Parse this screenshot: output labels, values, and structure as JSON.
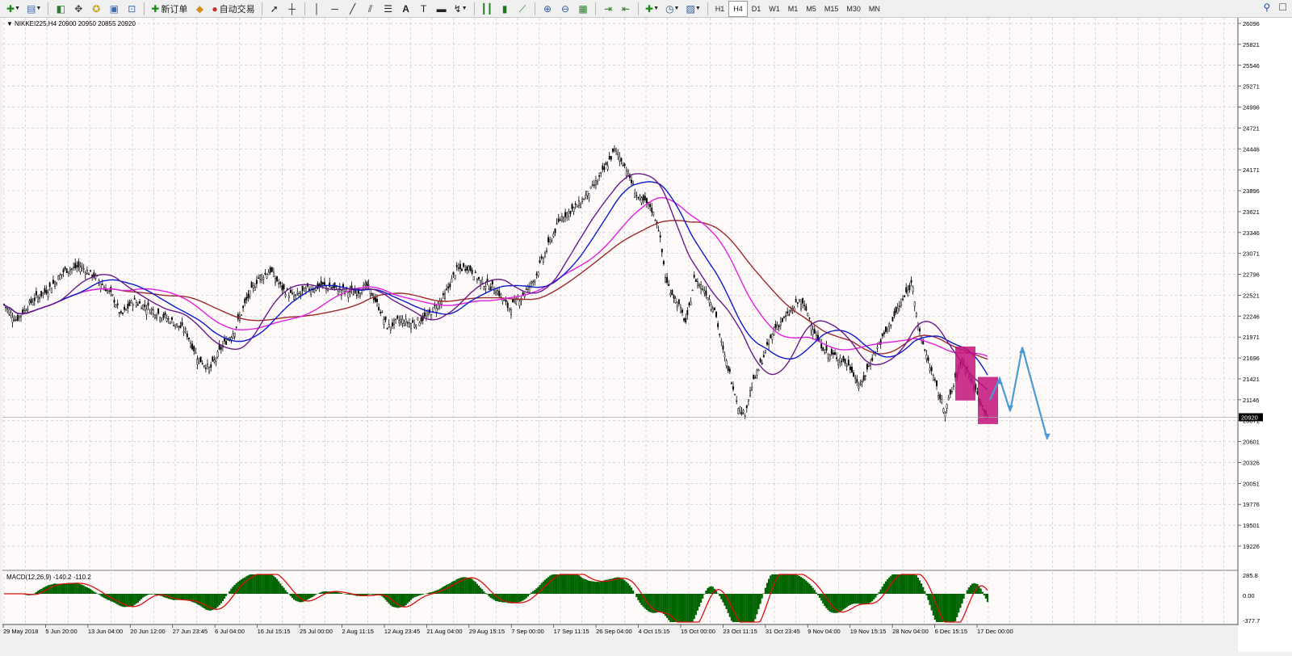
{
  "toolbar": {
    "new_order_label": "新订单",
    "auto_trade_label": "自动交易",
    "timeframes": [
      "H1",
      "H4",
      "D1",
      "W1",
      "M1",
      "M5",
      "M15",
      "M30",
      "MN"
    ],
    "active_timeframe": "H4"
  },
  "chart": {
    "header": "NIKKEI225,H4  20900 20950 20855 20920",
    "current_price_label": "20920",
    "y_axis_labels": [
      "26096",
      "25821",
      "25546",
      "25271",
      "24996",
      "24721",
      "24446",
      "24171",
      "23896",
      "23621",
      "23346",
      "23071",
      "22796",
      "22521",
      "22246",
      "21971",
      "21696",
      "21421",
      "21146",
      "20871",
      "20601",
      "20326",
      "20051",
      "19776",
      "19501",
      "19226"
    ],
    "x_axis_labels": [
      "29 May 2018",
      "5 Jun 20:00",
      "13 Jun 04:00",
      "20 Jun 12:00",
      "27 Jun 23:45",
      "6 Jul 04:00",
      "16 Jul 15:15",
      "25 Jul 00:00",
      "2 Aug 11:15",
      "12 Aug 23:45",
      "21 Aug 04:00",
      "29 Aug 15:15",
      "7 Sep 00:00",
      "17 Sep 11:15",
      "26 Sep 04:00",
      "4 Oct 15:15",
      "15 Oct 00:00",
      "23 Oct 11:15",
      "31 Oct 23:45",
      "9 Nov 04:00",
      "19 Nov 15:15",
      "28 Nov 04:00",
      "6 Dec 15:15",
      "17 Dec 00:00"
    ]
  },
  "macd": {
    "header": "MACD(12,26,9) -140.2 -110.2",
    "axis_labels": [
      "285.8",
      "0.00",
      "-377.7"
    ]
  },
  "colors": {
    "chart_bg": "#fffafa",
    "grid": "#c8c8c8",
    "candle": "#000000",
    "ma_brown": "#9b2a2a",
    "ma_magenta": "#e020e0",
    "ma_blue": "#0a1ccc",
    "ma_purple": "#6a1a8a",
    "box": "#c2127a",
    "arrow": "#4a9ad8",
    "macd_hist": "#006400",
    "macd_signal": "#d81010"
  }
}
